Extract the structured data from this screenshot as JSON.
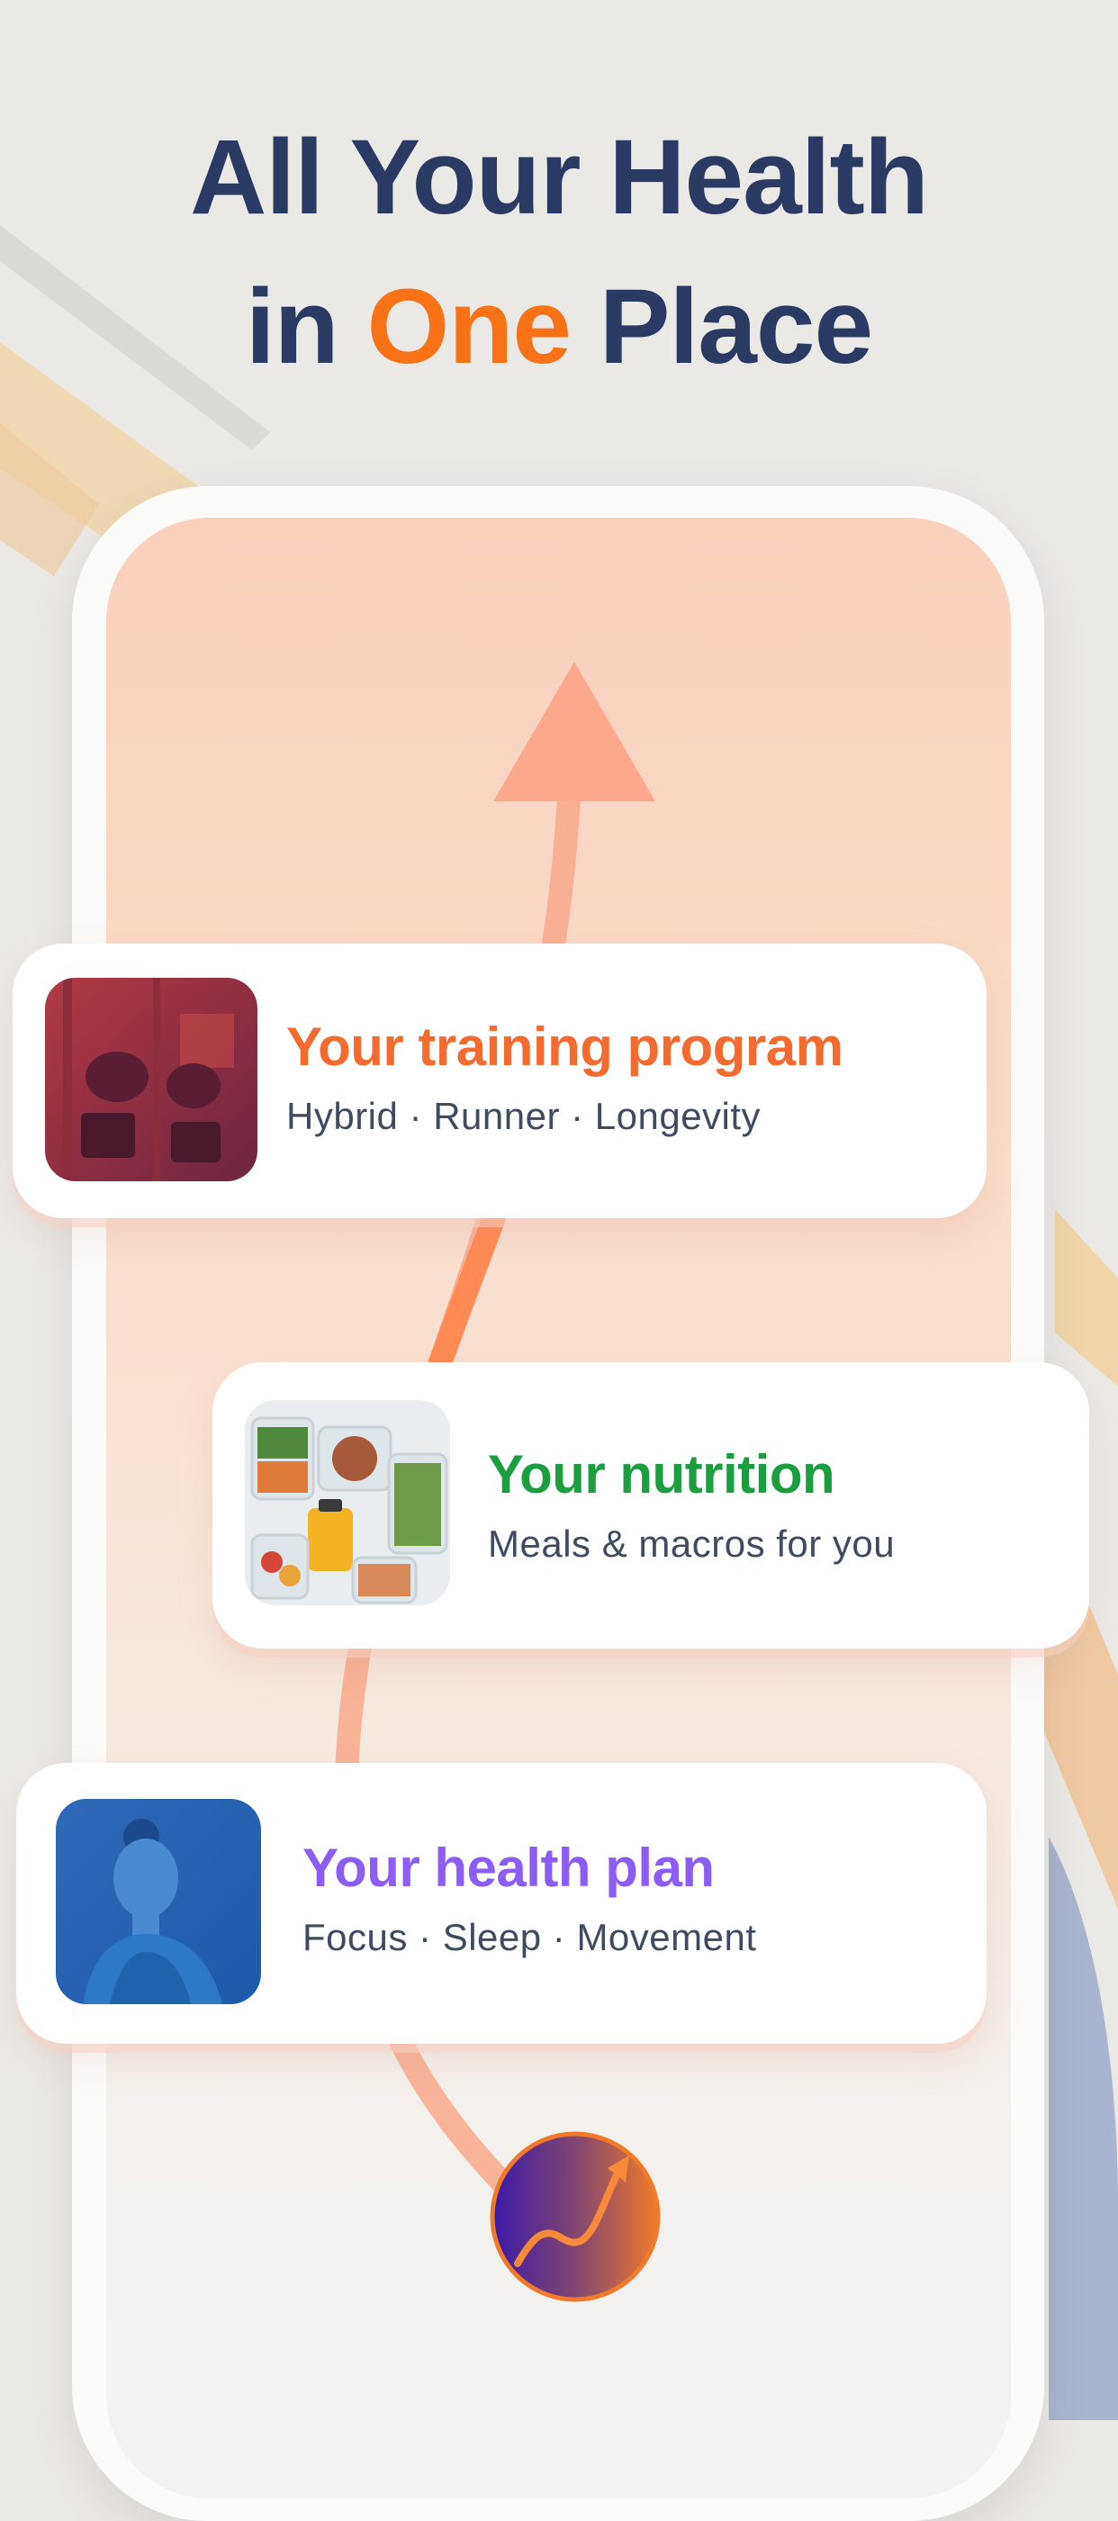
{
  "headline": {
    "line1": "All Your Health",
    "line2_prefix": "in",
    "line2_accent": "One",
    "line2_suffix": "Place"
  },
  "cards": [
    {
      "title": "Your training program",
      "subtitle": "Hybrid · Runner · Longevity",
      "title_color": "#f56a2e",
      "image": "training-photo"
    },
    {
      "title": "Your nutrition",
      "subtitle": "Meals & macros for you",
      "title_color": "#1a9e3f",
      "image": "meal-prep-photo"
    },
    {
      "title": "Your health plan",
      "subtitle": "Focus · Sleep · Movement",
      "title_color": "#8b5cf6",
      "image": "woman-meditating-photo"
    }
  ],
  "colors": {
    "headline": "#2b3a63",
    "accent": "#f97316",
    "background": "#ebe9e6"
  },
  "icons": {
    "arrow": "growth-arrow-icon",
    "logo": "app-logo-icon"
  }
}
